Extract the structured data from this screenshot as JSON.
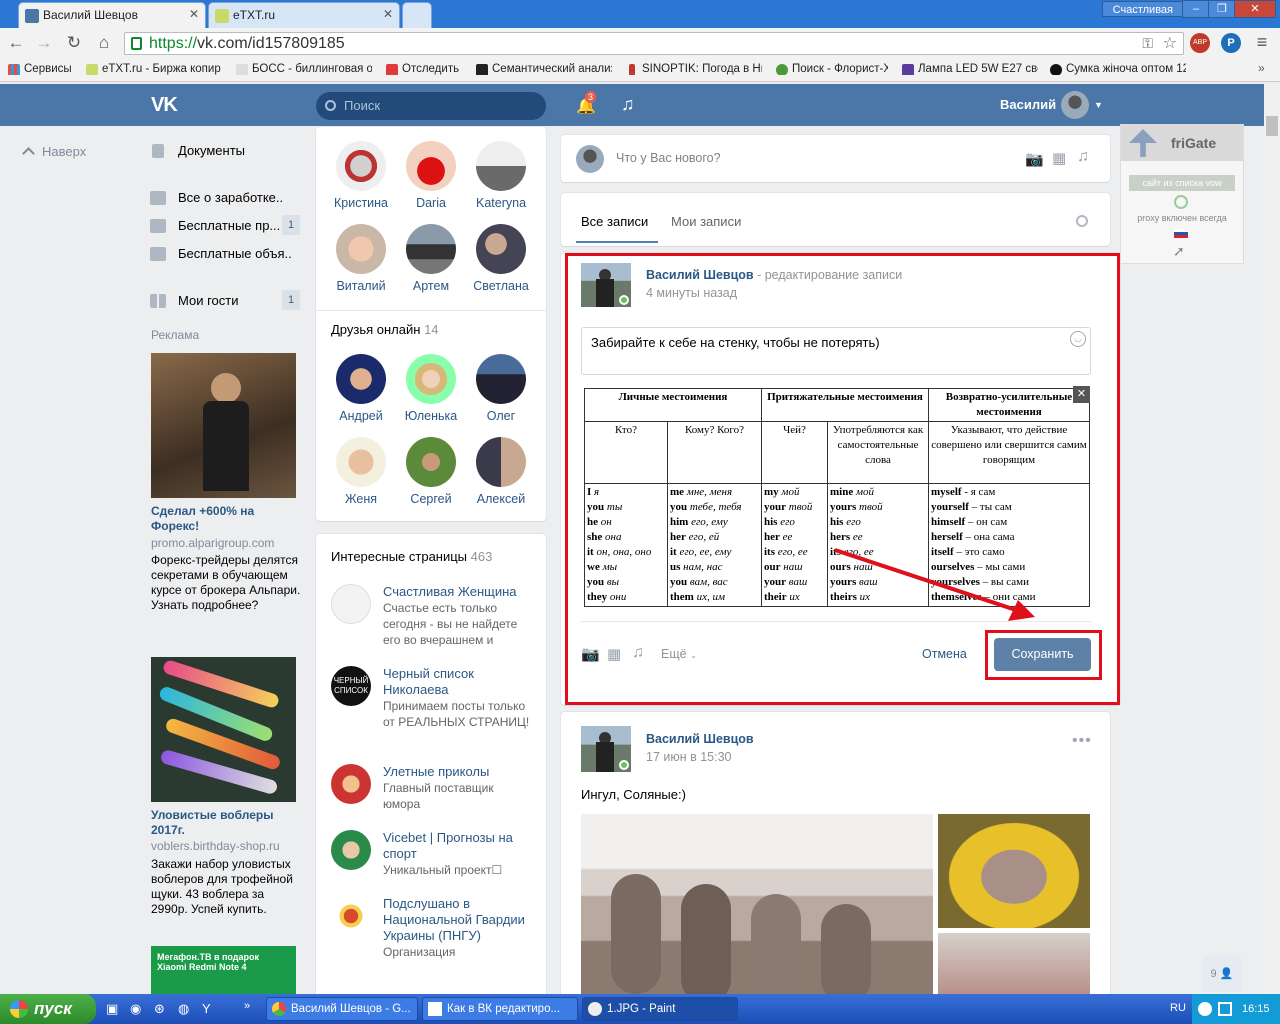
{
  "browser": {
    "tabs": [
      {
        "title": "Василий Шевцов"
      },
      {
        "title": "eTXT.ru"
      },
      {
        "title": ""
      }
    ],
    "profile_label": "Счастливая",
    "url_prefix": "https://",
    "url_rest": "vk.com/id157809185",
    "bookmarks": [
      "Сервисы",
      "eTXT.ru - Биржа копир",
      "БОСС - биллинговая ои",
      "Отследить",
      "Семантический анализ",
      "SINOPTIK: Погода в Ни",
      "Поиск - Флорист-Х",
      "Лампа LED 5W E27 свет",
      "Сумка жіноча оптом 12"
    ]
  },
  "vk_header": {
    "logo": "VK",
    "search_placeholder": "Поиск",
    "notifications_count": "3",
    "user_name": "Василий"
  },
  "left_nav": {
    "up_label": "Наверх",
    "items": [
      {
        "label": "Документы",
        "badge": ""
      },
      {
        "label": "Все о заработке..",
        "badge": ""
      },
      {
        "label": "Бесплатные пр...",
        "badge": "1"
      },
      {
        "label": "Бесплатные объя..",
        "badge": ""
      },
      {
        "label": "Мои гости",
        "badge": "1"
      }
    ],
    "ads_header": "Реклама",
    "ads": [
      {
        "title": "Сделал +600% на Форекс!",
        "domain": "promo.alparigroup.com",
        "text": "Форекс-трейдеры делятся секретами в обучающем курсе от брокера Альпари. Узнать подробнее?"
      },
      {
        "title": "Уловистые воблеры 2017г.",
        "domain": "voblers.birthday-shop.ru",
        "text": "Закажи набор уловистых воблеров для трофейной щуки. 43 воблера за 2990р. Успей купить."
      },
      {
        "banner_text": "Мегафон.ТВ в подарок Xiaomi Redmi Note 4"
      }
    ]
  },
  "friends": {
    "top": [
      "Кристина",
      "Daria",
      "Kateryna",
      "Виталий",
      "Артем",
      "Светлана"
    ],
    "online_header": "Друзья онлайн",
    "online_count": "14",
    "online": [
      "Андрей",
      "Юленька",
      "Олег",
      "Женя",
      "Сергей",
      "Алексей"
    ]
  },
  "pages": {
    "header": "Интересные страницы",
    "count": "463",
    "items": [
      {
        "title": "Счастливая Женщина",
        "desc": "Счастье есть только сегодня - вы не найдете его во вчерашнем и"
      },
      {
        "title": "Черный список Николаева",
        "desc": "Принимаем посты только от РЕАЛЬНЫХ СТРАНИЦ!"
      },
      {
        "title": "Улетные приколы",
        "desc": "Главный поставщик юмора"
      },
      {
        "title": "Vicebet | Прогнозы на спорт",
        "desc": "Уникальный проект☐"
      },
      {
        "title": "Подслушано в Национальной Гвардии Украины (ПНГУ)",
        "desc": "Организация"
      }
    ]
  },
  "composer": {
    "placeholder": "Что у Вас нового?"
  },
  "feed_tabs": {
    "all": "Все записи",
    "mine": "Мои записи"
  },
  "edit_post": {
    "author": "Василий Шевцов",
    "action": " - редактирование записи",
    "time": "4 минуты назад",
    "text": "Забирайте к себе на стенку, чтобы не потерять)",
    "more_label": "Ещё",
    "cancel_label": "Отмена",
    "save_label": "Сохранить",
    "table": {
      "headers": [
        "Личные местоимения",
        "Притяжательные местоимения",
        "Возвратно-усилительные местоимения"
      ],
      "subheaders": [
        "Кто?",
        "Кому? Кого?",
        "Чей?",
        "Употребляются как самостоятельные слова",
        "Указывают, что действие совершено или свершится самим говорящим"
      ],
      "col1": [
        [
          "I",
          "я"
        ],
        [
          "you",
          "ты"
        ],
        [
          "he",
          "он"
        ],
        [
          "she",
          "она"
        ],
        [
          "it",
          "он, она, оно"
        ],
        [
          "we",
          "мы"
        ],
        [
          "you",
          "вы"
        ],
        [
          "they",
          "они"
        ]
      ],
      "col2": [
        [
          "me",
          "мне, меня"
        ],
        [
          "you",
          "тебе, тебя"
        ],
        [
          "him",
          "его, ему"
        ],
        [
          "her",
          "его, ей"
        ],
        [
          "it",
          "его, ее, ему"
        ],
        [
          "us",
          "нам, нас"
        ],
        [
          "you",
          "вам, вас"
        ],
        [
          "them",
          "их, им"
        ]
      ],
      "col3": [
        [
          "my",
          "мой"
        ],
        [
          "your",
          "твой"
        ],
        [
          "his",
          "его"
        ],
        [
          "her",
          "ее"
        ],
        [
          "its",
          "его, ее"
        ],
        [
          "our",
          "наш"
        ],
        [
          "your",
          "ваш"
        ],
        [
          "their",
          "их"
        ]
      ],
      "col4": [
        [
          "mine",
          "мой"
        ],
        [
          "yours",
          "твой"
        ],
        [
          "his",
          "его"
        ],
        [
          "hers",
          "ее"
        ],
        [
          "its",
          "его, ее"
        ],
        [
          "ours",
          "наш"
        ],
        [
          "yours",
          "ваш"
        ],
        [
          "theirs",
          "их"
        ]
      ],
      "col5": [
        [
          "myself",
          " - я сам"
        ],
        [
          "yourself",
          " – ты сам"
        ],
        [
          "himself",
          " – он сам"
        ],
        [
          "herself",
          "– она сама"
        ],
        [
          "itself",
          "– это само"
        ],
        [
          "ourselves",
          " – мы сами"
        ],
        [
          "yourselves",
          " – вы сами"
        ],
        [
          "themselves",
          " – они сами"
        ]
      ]
    }
  },
  "post2": {
    "author": "Василий Шевцов",
    "time": "17 июн в 15:30",
    "text": "Ингул, Соляные:)"
  },
  "frigate": {
    "title": "friGate",
    "status": "сайт из списка vow",
    "proxy": "proxy включен всегда"
  },
  "chat_count": "9",
  "taskbar": {
    "start": "пуск",
    "tasks": [
      "Василий Шевцов - G...",
      "Как в ВК редактиро...",
      "1.JPG - Paint"
    ],
    "lang": "RU",
    "clock": "16:15"
  },
  "colors": {
    "vk_blue": "#4a76a8",
    "link": "#2a5885",
    "highlight_red": "#e0101a"
  }
}
